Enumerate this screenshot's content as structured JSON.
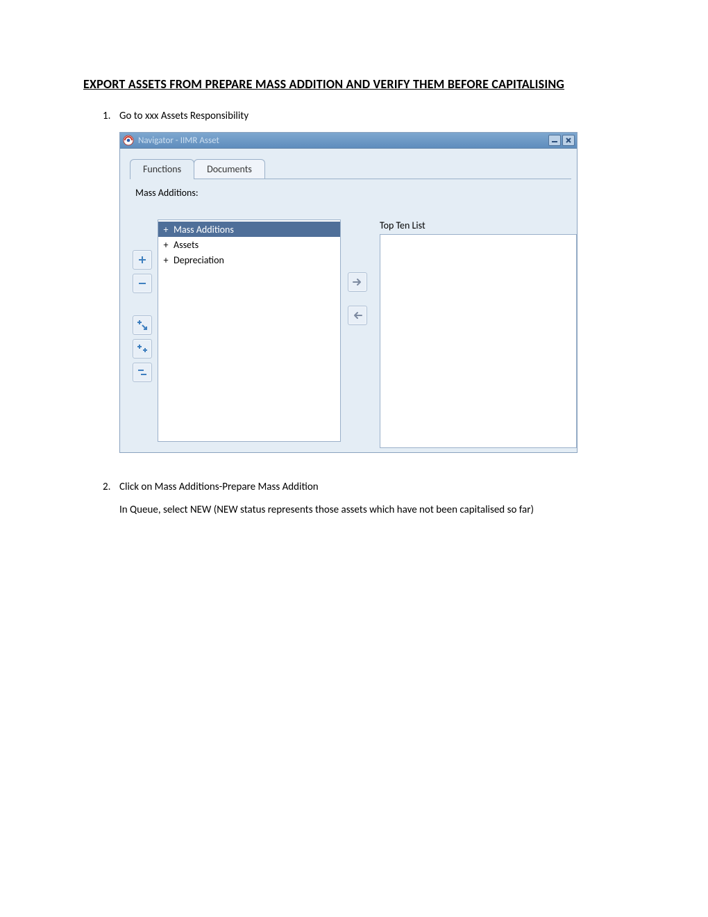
{
  "doc": {
    "title": "EXPORT ASSETS FROM PREPARE MASS ADDITION AND VERIFY THEM BEFORE CAPITALISING",
    "step1_num": "1.",
    "step1_text": "Go to xxx Assets Responsibility",
    "step2_num": "2.",
    "step2_text": "Click on Mass Additions-Prepare Mass Addition",
    "step2_sub": "In Queue, select NEW (NEW status represents those assets which have not been capitalised so far)"
  },
  "navigator": {
    "title": "Navigator - IIMR Asset",
    "tabs": {
      "functions": "Functions",
      "documents": "Documents"
    },
    "section_label": "Mass Additions:",
    "tree": {
      "item1": "Mass Additions",
      "item2": "Assets",
      "item3": "Depreciation",
      "expander": "+"
    },
    "top_ten_label": "Top Ten List"
  }
}
